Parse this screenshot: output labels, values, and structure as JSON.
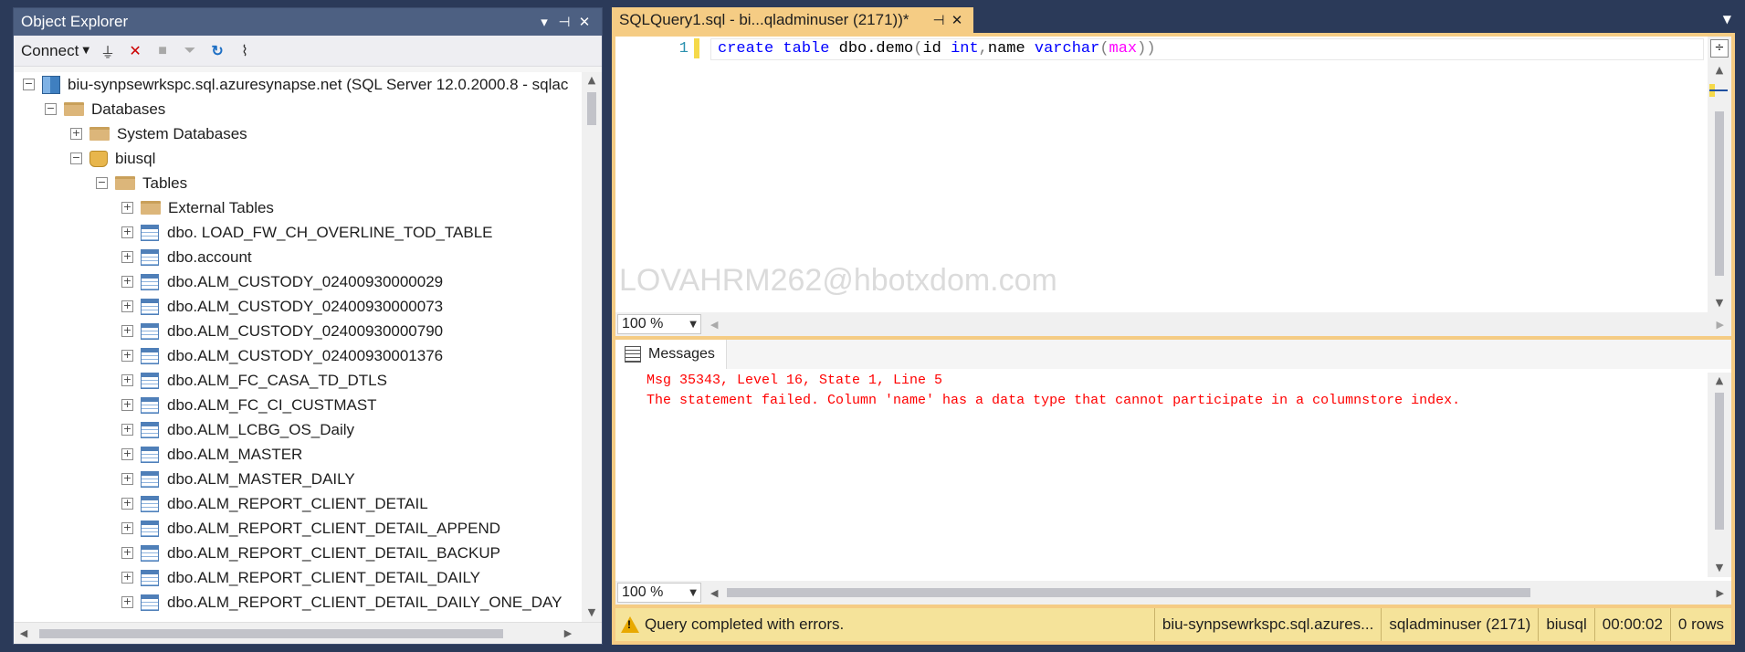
{
  "object_explorer": {
    "title": "Object Explorer",
    "title_buttons": [
      "▾",
      "⊣",
      "✕"
    ],
    "toolbar": {
      "connect_label": "Connect",
      "icons": [
        "connect-icon",
        "disconnect-icon",
        "stop-icon",
        "filter-icon",
        "refresh-icon",
        "activity-monitor-icon"
      ]
    },
    "tree": {
      "server": "biu-synpsewrkspc.sql.azuresynapse.net (SQL Server 12.0.2000.8 - sqlac",
      "databases": "Databases",
      "system_databases": "System Databases",
      "database": "biusql",
      "tables_folder": "Tables",
      "external_tables": "External Tables",
      "tables": [
        "dbo. LOAD_FW_CH_OVERLINE_TOD_TABLE",
        "dbo.account",
        "dbo.ALM_CUSTODY_02400930000029",
        "dbo.ALM_CUSTODY_02400930000073",
        "dbo.ALM_CUSTODY_02400930000790",
        "dbo.ALM_CUSTODY_02400930001376",
        "dbo.ALM_FC_CASA_TD_DTLS",
        "dbo.ALM_FC_CI_CUSTMAST",
        "dbo.ALM_LCBG_OS_Daily",
        "dbo.ALM_MASTER",
        "dbo.ALM_MASTER_DAILY",
        "dbo.ALM_REPORT_CLIENT_DETAIL",
        "dbo.ALM_REPORT_CLIENT_DETAIL_APPEND",
        "dbo.ALM_REPORT_CLIENT_DETAIL_BACKUP",
        "dbo.ALM_REPORT_CLIENT_DETAIL_DAILY",
        "dbo.ALM_REPORT_CLIENT_DETAIL_DAILY_ONE_DAY"
      ]
    }
  },
  "editor": {
    "tab_title": "SQLQuery1.sql - bi...qladminuser (2171))*",
    "line_number": "1",
    "code": {
      "kw1": "create table",
      "t1": " dbo.demo",
      "p1": "(",
      "t2": "id ",
      "kw2": "int",
      "p2": ",",
      "t3": "name ",
      "kw3": "varchar",
      "p3": "(",
      "fn1": "max",
      "p4": "))"
    },
    "watermark": "LOVAHRM262@hbotxdom.com",
    "zoom": "100 %"
  },
  "results": {
    "messages_tab": "Messages",
    "lines": [
      "Msg 35343, Level 16, State 1, Line 5",
      "The statement failed. Column 'name' has a data type that cannot participate in a columnstore index."
    ],
    "zoom": "100 %"
  },
  "status_bar": {
    "message": "Query completed with errors.",
    "server": "biu-synpsewrkspc.sql.azures...",
    "user": "sqladminuser (2171)",
    "database": "biusql",
    "elapsed": "00:00:02",
    "rows": "0 rows"
  },
  "colors": {
    "accent_tab": "#f5cc84",
    "panel_title": "#4d6082",
    "status_bar": "#f5e39a",
    "error_text": "#ff0000"
  }
}
